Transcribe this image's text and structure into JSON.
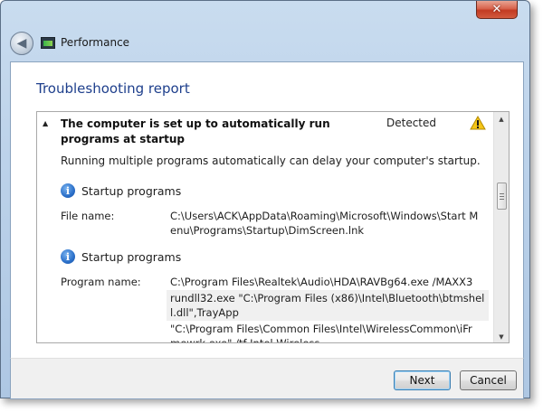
{
  "window": {
    "close_glyph": "✕",
    "back_glyph": "◀",
    "title": "Performance"
  },
  "content": {
    "heading": "Troubleshooting report"
  },
  "issue": {
    "title": "The computer is set up to automatically run programs at startup",
    "status": "Detected",
    "description": "Running multiple programs automatically can delay your computer's startup."
  },
  "sections": [
    {
      "heading": "Startup programs",
      "label": "File name:",
      "values": [
        "C:\\Users\\ACK\\AppData\\Roaming\\Microsoft\\Windows\\Start Menu\\Programs\\Startup\\DimScreen.lnk"
      ]
    },
    {
      "heading": "Startup programs",
      "label": "Program name:",
      "values": [
        "C:\\Program Files\\Realtek\\Audio\\HDA\\RAVBg64.exe /MAXX3",
        "rundll32.exe \"C:\\Program Files (x86)\\Intel\\Bluetooth\\btmshell.dll\",TrayApp",
        "\"C:\\Program Files\\Common Files\\Intel\\WirelessCommon\\iFrmewrk.exe\" /tf Intel Wireless"
      ]
    }
  ],
  "footer": {
    "next_label": "Next",
    "cancel_label": "Cancel"
  },
  "icons": {
    "warning": "warning-icon",
    "info": "info-icon",
    "back": "back-arrow-icon",
    "app": "performance-icon"
  },
  "colors": {
    "heading": "#1e3f8c",
    "close_button": "#c23a22",
    "default_button_border": "#3c7fb1"
  }
}
